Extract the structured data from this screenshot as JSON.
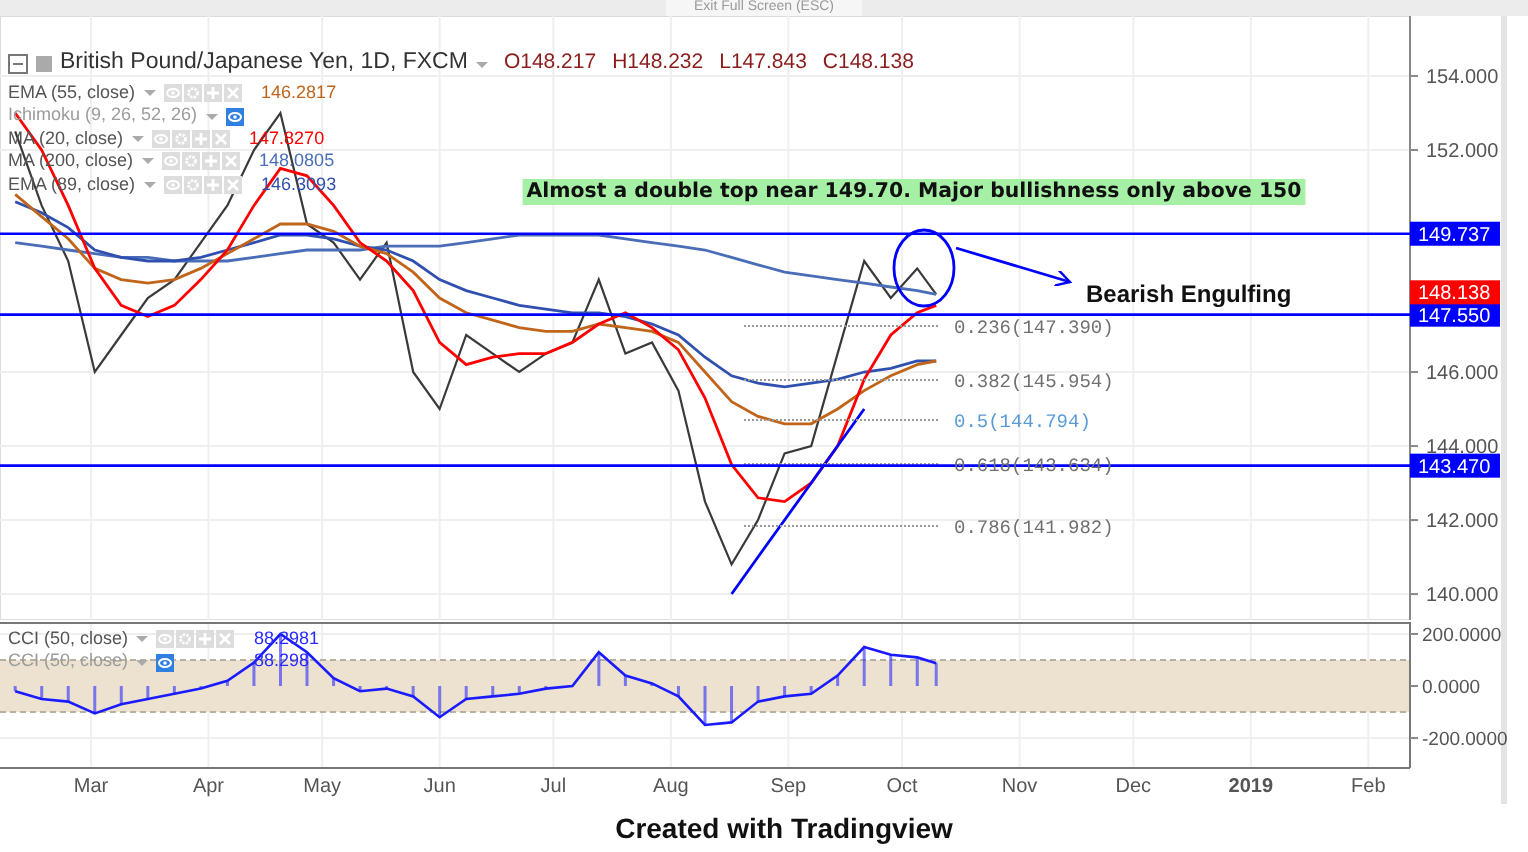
{
  "exit_fullscreen_button": "Exit Full Screen (ESC)",
  "symbol_legend": {
    "title": "British Pound/Japanese Yen, 1D, FXCM",
    "ohlc": [
      "O148.217",
      "H148.232",
      "L147.843",
      "C148.138"
    ]
  },
  "indicators": [
    {
      "name": "EMA (55, close)",
      "value": "146.2817",
      "color": "#c0651a",
      "disabled": false
    },
    {
      "name": "Ichimoku (9, 26, 52, 26)",
      "disabled": true
    },
    {
      "name": "MA (20, close)",
      "value": "147.8270",
      "color": "#ff0000",
      "disabled": false
    },
    {
      "name": "MA (200, close)",
      "value": "148.0805",
      "color": "#4a6db8",
      "disabled": false
    },
    {
      "name": "EMA (89, close)",
      "value": "146.3093",
      "color": "#3050b0",
      "disabled": false
    }
  ],
  "price_chart": {
    "chart_data": {
      "type": "line",
      "grid": true,
      "xlim": [
        "2018-02-05",
        "2019-02-12"
      ],
      "ylim": [
        139.3,
        155.62
      ],
      "x": [
        "2018-02-09",
        "2018-02-16",
        "2018-02-23",
        "2018-03-02",
        "2018-03-09",
        "2018-03-16",
        "2018-03-23",
        "2018-03-30",
        "2018-04-06",
        "2018-04-13",
        "2018-04-20",
        "2018-04-27",
        "2018-05-04",
        "2018-05-11",
        "2018-05-18",
        "2018-05-25",
        "2018-06-01",
        "2018-06-08",
        "2018-06-15",
        "2018-06-22",
        "2018-06-29",
        "2018-07-06",
        "2018-07-13",
        "2018-07-20",
        "2018-07-27",
        "2018-08-03",
        "2018-08-10",
        "2018-08-17",
        "2018-08-24",
        "2018-08-31",
        "2018-09-07",
        "2018-09-14",
        "2018-09-21",
        "2018-09-28",
        "2018-10-05",
        "2018-10-10"
      ],
      "series": [
        {
          "color": "#3a3a3a",
          "values": [
            152.5,
            150.5,
            149.0,
            146.0,
            147.0,
            148.0,
            148.5,
            149.5,
            150.5,
            152.0,
            153.0,
            150.0,
            149.5,
            148.5,
            149.5,
            146.0,
            145.0,
            147.0,
            146.5,
            146.0,
            146.5,
            146.8,
            148.5,
            146.5,
            146.8,
            145.5,
            142.5,
            140.8,
            142.0,
            143.8,
            144.0,
            146.5,
            149.0,
            148.0,
            148.8,
            148.1
          ]
        },
        {
          "color": "#4a6db8",
          "values": [
            149.5,
            149.4,
            149.3,
            149.2,
            149.1,
            149.1,
            149.0,
            149.0,
            149.0,
            149.1,
            149.2,
            149.3,
            149.3,
            149.3,
            149.4,
            149.4,
            149.4,
            149.5,
            149.6,
            149.7,
            149.7,
            149.7,
            149.7,
            149.6,
            149.5,
            149.4,
            149.3,
            149.1,
            148.9,
            148.7,
            148.6,
            148.5,
            148.4,
            148.3,
            148.2,
            148.1
          ]
        },
        {
          "color": "#3050b0",
          "values": [
            150.6,
            150.3,
            149.9,
            149.3,
            149.1,
            149.0,
            149.0,
            149.1,
            149.3,
            149.5,
            149.7,
            149.7,
            149.6,
            149.4,
            149.3,
            149.0,
            148.5,
            148.2,
            148.0,
            147.8,
            147.7,
            147.6,
            147.6,
            147.5,
            147.3,
            147.0,
            146.4,
            145.9,
            145.7,
            145.6,
            145.7,
            145.8,
            146.0,
            146.1,
            146.3,
            146.3
          ]
        },
        {
          "color": "#c0651a",
          "values": [
            150.8,
            150.2,
            149.6,
            148.8,
            148.5,
            148.4,
            148.5,
            148.8,
            149.2,
            149.6,
            150.0,
            150.0,
            149.8,
            149.4,
            149.2,
            148.7,
            148.0,
            147.6,
            147.4,
            147.2,
            147.1,
            147.1,
            147.3,
            147.2,
            147.1,
            146.8,
            146.0,
            145.2,
            144.8,
            144.6,
            144.6,
            145.0,
            145.5,
            145.9,
            146.2,
            146.3
          ]
        },
        {
          "color": "#ff0000",
          "values": [
            153.0,
            152.0,
            150.5,
            148.8,
            147.8,
            147.5,
            147.8,
            148.5,
            149.3,
            150.5,
            151.5,
            151.3,
            150.5,
            149.5,
            149.0,
            148.2,
            146.8,
            146.2,
            146.4,
            146.5,
            146.5,
            146.8,
            147.3,
            147.6,
            147.2,
            146.6,
            145.3,
            143.5,
            142.6,
            142.5,
            143.0,
            144.0,
            145.8,
            147.0,
            147.6,
            147.8
          ]
        },
        {
          "color": "#0000ff",
          "values": [
            null,
            null,
            null,
            null,
            null,
            null,
            null,
            null,
            null,
            null,
            null,
            null,
            null,
            null,
            null,
            null,
            null,
            null,
            null,
            null,
            null,
            null,
            null,
            null,
            null,
            null,
            null,
            140.0,
            141.0,
            142.0,
            143.0,
            144.0,
            145.0,
            null,
            null,
            null
          ]
        }
      ],
      "yticks": [
        {
          "value": 140,
          "label": "140.000"
        },
        {
          "value": 142,
          "label": "142.000"
        },
        {
          "value": 144,
          "label": "144.000"
        },
        {
          "value": 146,
          "label": "146.000"
        },
        {
          "value": 152,
          "label": "152.000"
        },
        {
          "value": 154,
          "label": "154.000"
        }
      ],
      "ref_lines": [
        {
          "axis": "y",
          "value": 149.737,
          "label": "149.737",
          "color": "#0000ff"
        },
        {
          "axis": "y",
          "value": 147.55,
          "label": "147.550",
          "color": "#0000ff"
        },
        {
          "axis": "y",
          "value": 143.47,
          "label": "143.470",
          "color": "#0000ff"
        }
      ],
      "annotations": [
        "Almost a double top near 149.70. Major bullishness only above 150",
        "Bearish Engulfing",
        "0.236(147.390)",
        "0.382(145.954)",
        "0.5(144.794)",
        "0.618(143.634)",
        "0.786(141.982)"
      ]
    },
    "last_price": "148.138"
  },
  "cci_legends": [
    {
      "name": "CCI (50, close)",
      "value": "88.2981",
      "disabled": false
    },
    {
      "name": "CCI (50, close)",
      "value": "88.298",
      "disabled": true
    }
  ],
  "cci_chart": {
    "chart_data": {
      "type": "line",
      "grid": true,
      "xlim": [
        "2018-02-05",
        "2019-02-12"
      ],
      "ylim": [
        -315,
        246
      ],
      "x": [
        "2018-02-09",
        "2018-02-16",
        "2018-02-23",
        "2018-03-02",
        "2018-03-09",
        "2018-03-16",
        "2018-03-23",
        "2018-03-30",
        "2018-04-06",
        "2018-04-13",
        "2018-04-20",
        "2018-04-27",
        "2018-05-04",
        "2018-05-11",
        "2018-05-18",
        "2018-05-25",
        "2018-06-01",
        "2018-06-08",
        "2018-06-15",
        "2018-06-22",
        "2018-06-29",
        "2018-07-06",
        "2018-07-13",
        "2018-07-20",
        "2018-07-27",
        "2018-08-03",
        "2018-08-10",
        "2018-08-17",
        "2018-08-24",
        "2018-08-31",
        "2018-09-07",
        "2018-09-14",
        "2018-09-21",
        "2018-09-28",
        "2018-10-05",
        "2018-10-10"
      ],
      "series": [
        {
          "color": "#1a1aff",
          "values": [
            -20,
            -50,
            -60,
            -105,
            -70,
            -50,
            -30,
            -10,
            20,
            90,
            200,
            130,
            30,
            -20,
            -10,
            -40,
            -120,
            -50,
            -40,
            -30,
            -10,
            0,
            130,
            40,
            10,
            -40,
            -150,
            -140,
            -60,
            -40,
            -30,
            40,
            150,
            120,
            110,
            88
          ]
        }
      ],
      "yticks": [
        {
          "value": 200,
          "label": "200.0000"
        },
        {
          "value": 0,
          "label": "0.0000"
        },
        {
          "value": -200,
          "label": "-200.0000"
        }
      ],
      "xticks": [
        {
          "value": "2018-03-01",
          "label": "Mar"
        },
        {
          "value": "2018-04-01",
          "label": "Apr"
        },
        {
          "value": "2018-05-01",
          "label": "May"
        },
        {
          "value": "2018-06-01",
          "label": "Jun"
        },
        {
          "value": "2018-07-01",
          "label": "Jul"
        },
        {
          "value": "2018-08-01",
          "label": "Aug"
        },
        {
          "value": "2018-09-01",
          "label": "Sep"
        },
        {
          "value": "2018-10-01",
          "label": "Oct"
        },
        {
          "value": "2018-11-01",
          "label": "Nov"
        },
        {
          "value": "2018-12-01",
          "label": "Dec"
        },
        {
          "value": "2019-01-01",
          "label": "2019"
        },
        {
          "value": "2019-02-01",
          "label": "Feb"
        }
      ],
      "bands": [
        {
          "axis": "y",
          "from": -100,
          "to": 100,
          "color": "#ece2cf"
        }
      ],
      "ref_lines": [
        {
          "axis": "y",
          "value": 100,
          "color": "#b8b0a0"
        },
        {
          "axis": "y",
          "value": -100,
          "color": "#b8b0a0"
        }
      ]
    }
  },
  "footer": "Created with Tradingview"
}
